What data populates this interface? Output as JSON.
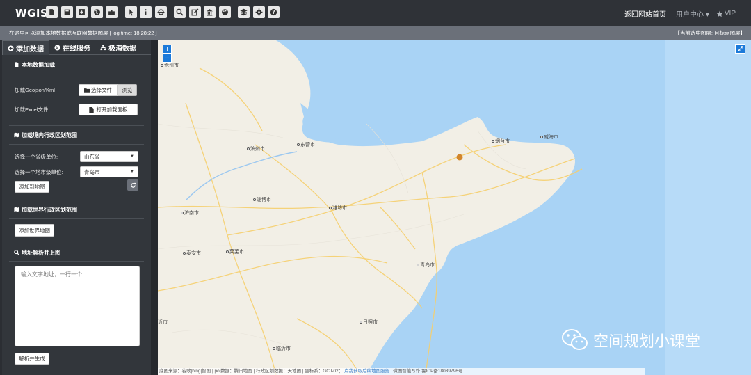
{
  "app": {
    "logo": "WGIS"
  },
  "toolbar": {
    "icons": [
      "file-icon",
      "save-icon",
      "plus-square-icon",
      "globe-icon",
      "puzzle-icon",
      "pointer-icon",
      "info-icon",
      "crosshair-icon",
      "zoom-icon",
      "edit-icon",
      "bank-icon",
      "palette-icon",
      "layers-icon",
      "gear-icon",
      "help-icon"
    ]
  },
  "nav": {
    "home": "返回网站首页",
    "user": "用户中心 ▾",
    "vip": "VIP"
  },
  "status": {
    "left": "在这里可以添加本地数据或互联网数据图层 [ log time: 18:28:22 ]",
    "right": "【当前选中图层: 目标点图层】"
  },
  "sidebar": {
    "tabs": [
      {
        "label": "添加数据",
        "icon": "plus-circle-icon"
      },
      {
        "label": "在线服务",
        "icon": "globe-icon"
      },
      {
        "label": "极海数据",
        "icon": "sitemap-icon"
      }
    ],
    "local": {
      "title": "本地数据加载",
      "geojson_label": "加载Geojson/Kml",
      "choose_file": "选择文件",
      "browse": "浏览",
      "excel_label": "加载Excel文件",
      "open_panel": "打开加载面板"
    },
    "admin": {
      "title": "加载境内行政区划范围",
      "province_label": "选择一个省级单位:",
      "province_value": "山东省",
      "city_label": "选择一个地市级单位:",
      "city_value": "青岛市",
      "add_button": "添加到地图"
    },
    "world": {
      "title": "加载世界行政区划范围",
      "add_button": "添加世界地图"
    },
    "geocode": {
      "title": "地址解析并上图",
      "placeholder": "输入文字地址，一行一个",
      "button": "解析并生成"
    }
  },
  "map": {
    "zoom_in": "+",
    "zoom_out": "−",
    "attribution": "底图来源：谷歌|bing|智图 | poi数据：腾讯地图 | 行政区划数据：天地图 | 坐标系：GCJ-02；",
    "attribution_link": "点我获取后续地图服务",
    "attribution_tail": " | 微图智能写作 鲁ICP备18039796号",
    "watermark": "空间规划小课堂",
    "cities": [
      "沧州市",
      "滨州市",
      "东营市",
      "烟台市",
      "威海市",
      "淄博市",
      "济南市",
      "潍坊市",
      "泰安市",
      "莱芜市",
      "青岛市",
      "日照市",
      "临沂市",
      "沂市"
    ]
  },
  "colors": {
    "accent": "#1c7ad9",
    "marker": "#d2862b",
    "water": "#a9d3f5",
    "land": "#f2efe6"
  }
}
